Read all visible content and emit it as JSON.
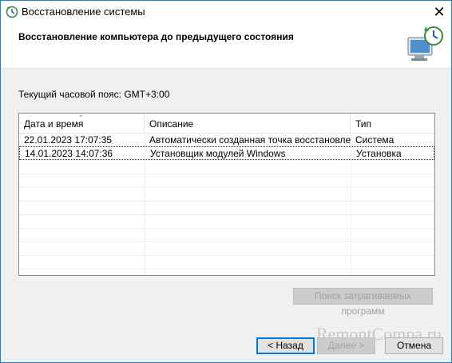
{
  "window": {
    "title": "Восстановление системы"
  },
  "header": {
    "title": "Восстановление компьютера до предыдущего состояния"
  },
  "timezone": "Текущий часовой пояс: GMT+3:00",
  "table": {
    "columns": [
      "Дата и время",
      "Описание",
      "Тип"
    ],
    "rows": [
      {
        "date": "22.01.2023 17:07:35",
        "description": "Автоматически созданная точка восстановле...",
        "type": "Система"
      },
      {
        "date": "14.01.2023 14:07:36",
        "description": "Установщик модулей Windows",
        "type": "Установка"
      }
    ]
  },
  "buttons": {
    "scan": "Поиск затрагиваемых программ",
    "back": "< Назад",
    "next": "Далее >",
    "cancel": "Отмена"
  },
  "watermark": "RemontCompa.ru",
  "colors": {
    "accent": "#0078d7",
    "window_border": "#1883d7"
  }
}
